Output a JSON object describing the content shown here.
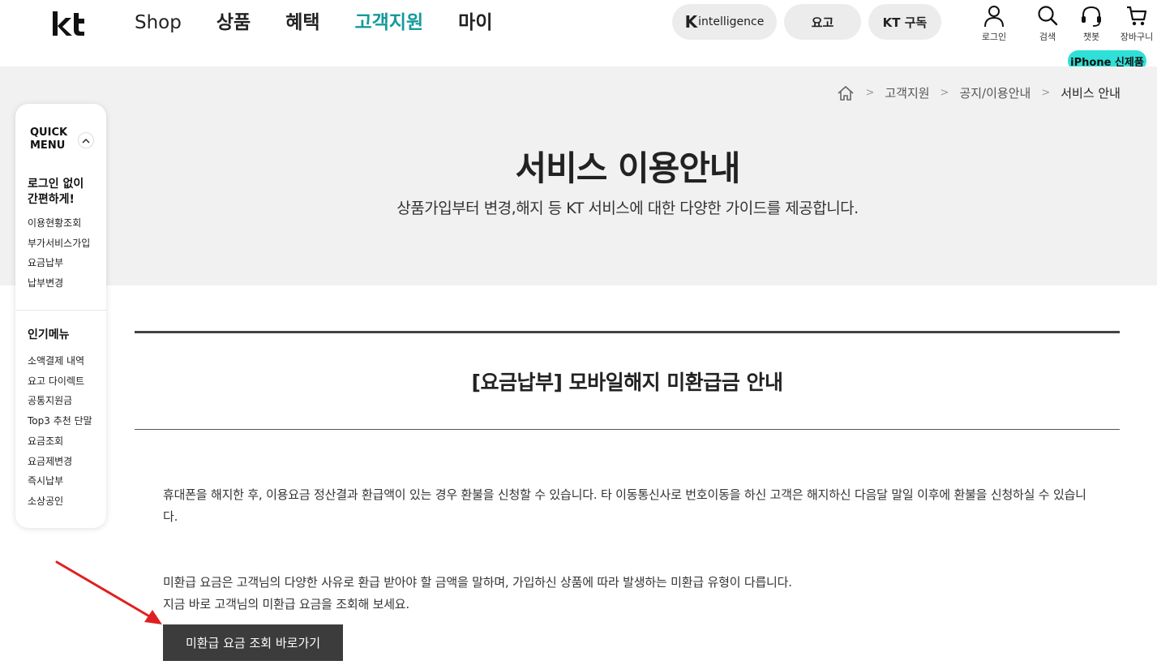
{
  "header": {
    "logo_text": "kt",
    "nav": [
      "Shop",
      "상품",
      "혜택",
      "고객지원",
      "마이"
    ],
    "pills": {
      "k_intelligence_k": "K",
      "k_intelligence_text": "intelligence",
      "fee": "요고",
      "subscribe": "KT 구독"
    },
    "utils": {
      "login": "로그인",
      "search": "검색",
      "chatbot": "챗봇",
      "cart": "장바구니"
    },
    "badge": "iPhone 신제품"
  },
  "breadcrumb": {
    "items": [
      "고객지원",
      "공지/이용안내",
      "서비스 안내"
    ],
    "separator": ">"
  },
  "hero": {
    "title": "서비스 이용안내",
    "subtitle": "상품가입부터 변경,해지 등 KT 서비스에 대한 다양한 가이드를 제공합니다."
  },
  "quick_menu": {
    "title_line1": "QUICK",
    "title_line2": "MENU",
    "section1_title_line1": "로그인 없이",
    "section1_title_line2": "간편하게!",
    "section1_items": [
      "이용현황조회",
      "부가서비스가입",
      "요금납부",
      "납부변경"
    ],
    "section2_title": "인기메뉴",
    "section2_items": [
      "소액결제 내역",
      "요고 다이렉트",
      "공통지원금",
      "Top3 추천 단말",
      "요금조회",
      "요금제변경",
      "즉시납부",
      "소상공인"
    ]
  },
  "content": {
    "title": "[요금납부] 모바일해지 미환급금 안내",
    "paragraph1": "휴대폰을 해지한 후, 이용요금 정산결과 환급액이 있는 경우 환불을 신청할 수 있습니다. 타 이동통신사로 번호이동을 하신 고객은 해지하신 다음달 말일 이후에 환불을 신청하실 수 있습니다.",
    "paragraph2_line1": "미환급 요금은 고객님의 다양한 사유로 환급 받아야 할 금액을 말하며, 가입하신 상품에 따라 발생하는 미환급 유형이 다릅니다.",
    "paragraph2_line2": "지금 바로 고객님의 미환급 요금을 조회해 보세요.",
    "cta_label": "미환급 요금 조회 바로가기"
  },
  "colors": {
    "accent_teal": "#159a9c",
    "badge_mint": "#2ee0d7",
    "hero_bg": "#f1f1f1",
    "button_dark": "#3c3c3c",
    "annotation_arrow": "#e02020"
  }
}
